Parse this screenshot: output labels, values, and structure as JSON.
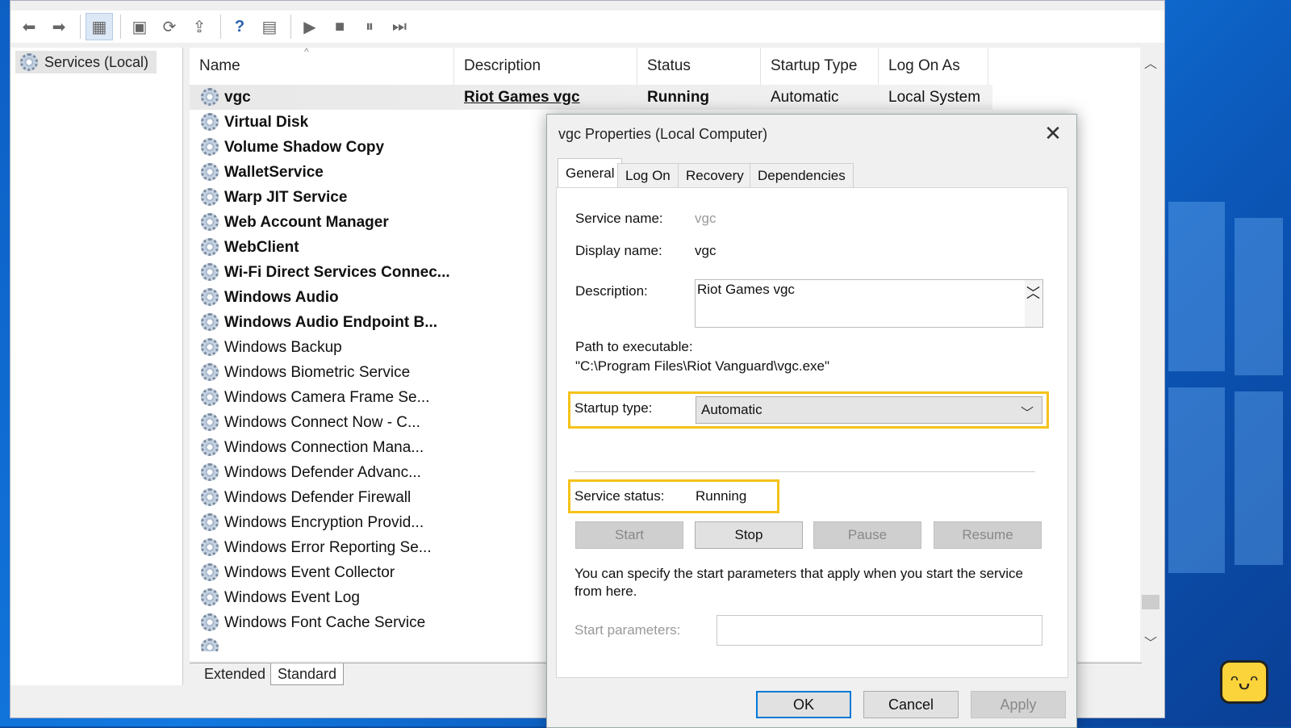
{
  "tree": {
    "root_label": "Services (Local)"
  },
  "columns": [
    "Name",
    "Description",
    "Status",
    "Startup Type",
    "Log On As"
  ],
  "selected_row": {
    "name": "vgc",
    "description": "Riot Games vgc",
    "status": "Running",
    "startup": "Automatic",
    "logon": "Local System"
  },
  "services": [
    "Virtual Disk",
    "Volume Shadow Copy",
    "WalletService",
    "Warp JIT Service",
    "Web Account Manager",
    "WebClient",
    "Wi-Fi Direct Services Connec...",
    "Windows Audio",
    "Windows Audio Endpoint B...",
    "Windows Backup",
    "Windows Biometric Service",
    "Windows Camera Frame Se...",
    "Windows Connect Now - C...",
    "Windows Connection Mana...",
    "Windows Defender Advanc...",
    "Windows Defender Firewall",
    "Windows Encryption Provid...",
    "Windows Error Reporting Se...",
    "Windows Event Collector",
    "Windows Event Log",
    "Windows Font Cache Service"
  ],
  "bottom_tabs": {
    "extended": "Extended",
    "standard": "Standard"
  },
  "dialog": {
    "title": "vgc Properties (Local Computer)",
    "tabs": {
      "general": "General",
      "logon": "Log On",
      "recovery": "Recovery",
      "dependencies": "Dependencies"
    },
    "service_name_label": "Service name:",
    "service_name_value": "vgc",
    "display_name_label": "Display name:",
    "display_name_value": "vgc",
    "description_label": "Description:",
    "description_value": "Riot Games vgc",
    "path_label": "Path to executable:",
    "path_value": "\"C:\\Program Files\\Riot Vanguard\\vgc.exe\"",
    "startup_label": "Startup type:",
    "startup_value": "Automatic",
    "status_label": "Service status:",
    "status_value": "Running",
    "buttons": {
      "start": "Start",
      "stop": "Stop",
      "pause": "Pause",
      "resume": "Resume"
    },
    "hint": "You can specify the start parameters that apply when you start the service",
    "hint2": "from here.",
    "params_label": "Start parameters:",
    "ok": "OK",
    "cancel": "Cancel",
    "apply": "Apply"
  },
  "colors": {
    "highlight": "#f5c219",
    "accent": "#0078d7"
  }
}
